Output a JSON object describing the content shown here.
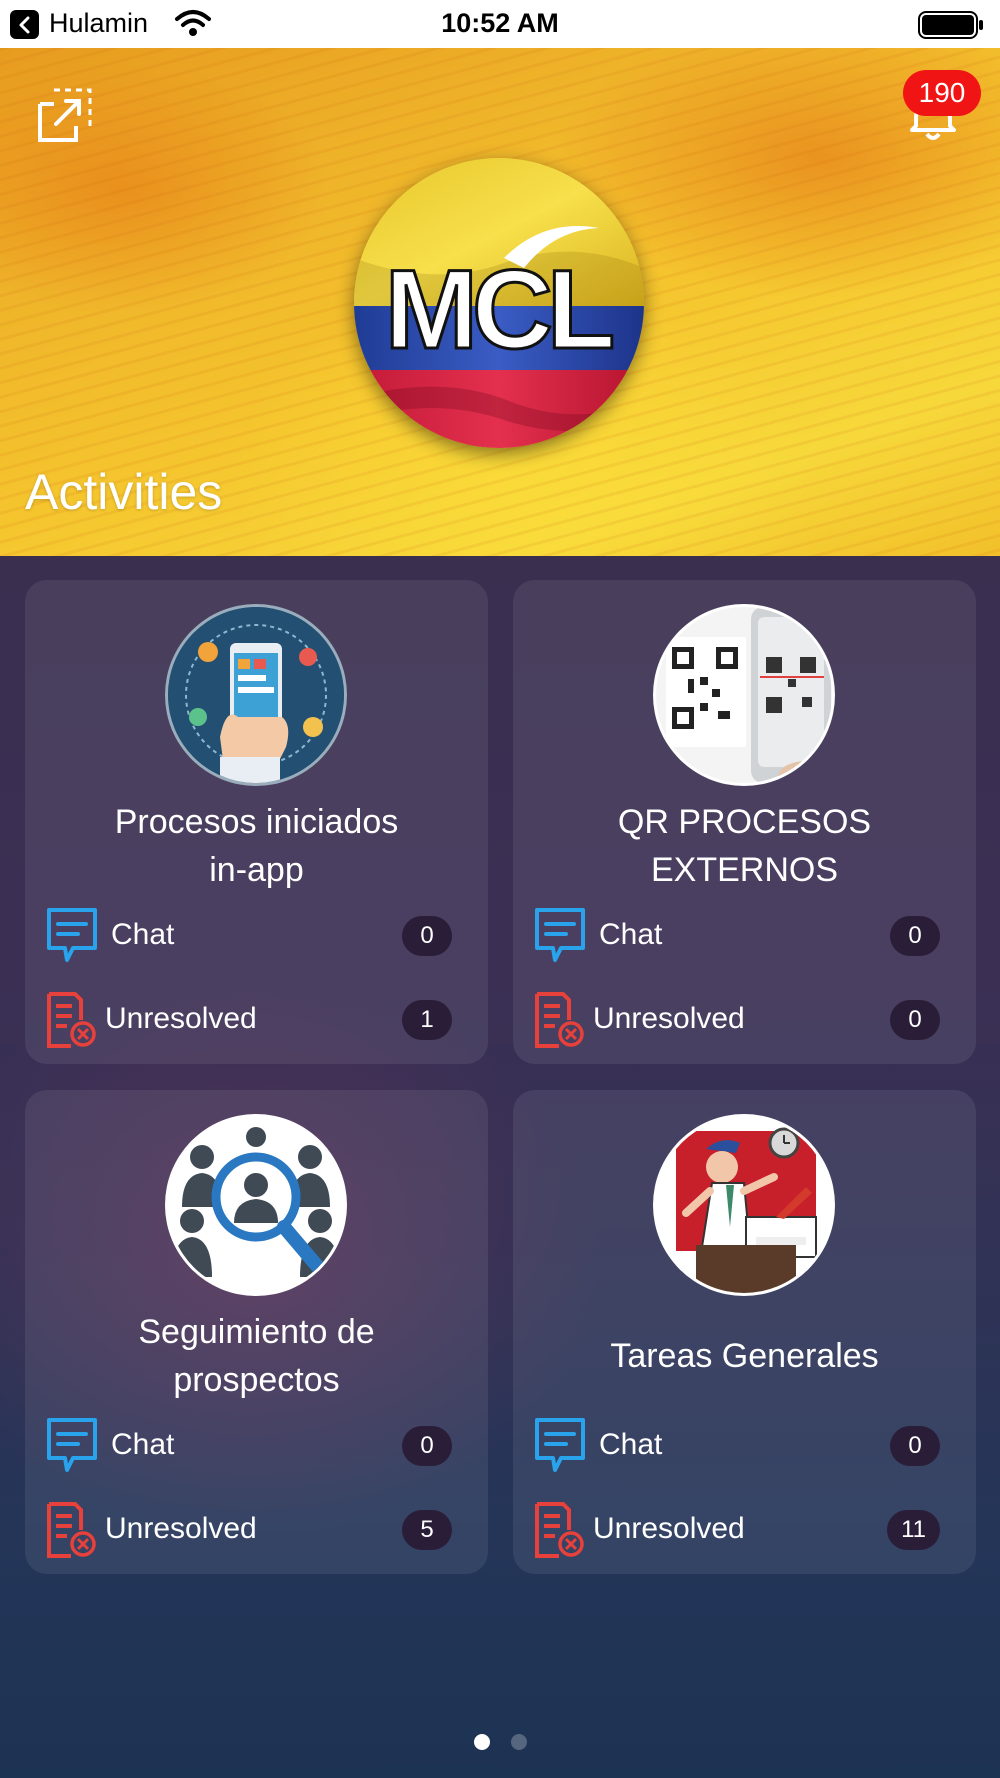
{
  "status_bar": {
    "carrier": "Hulamin",
    "time": "10:52 AM",
    "back_icon": "back-arrow-icon",
    "wifi_icon": "wifi-icon",
    "battery_icon": "battery-icon"
  },
  "header": {
    "title": "Activities",
    "notification_count": "190",
    "logo_text": "MCL",
    "share_icon": "share-icon",
    "bell_icon": "bell-icon",
    "colors": {
      "flag_yellow": "#f3d235",
      "flag_blue": "#2a49a8",
      "flag_red": "#d8233f",
      "badge": "#f01414"
    }
  },
  "cards": [
    {
      "title_line1": "Procesos iniciados",
      "title_line2": "in-app",
      "image": "mobile-app-illustration",
      "chat_label": "Chat",
      "chat_count": "0",
      "unresolved_label": "Unresolved",
      "unresolved_count": "1"
    },
    {
      "title_line1": "QR PROCESOS",
      "title_line2": "EXTERNOS",
      "image": "qr-code-scan-illustration",
      "chat_label": "Chat",
      "chat_count": "0",
      "unresolved_label": "Unresolved",
      "unresolved_count": "0"
    },
    {
      "title_line1": "Seguimiento de",
      "title_line2": "prospectos",
      "image": "prospect-search-illustration",
      "chat_label": "Chat",
      "chat_count": "0",
      "unresolved_label": "Unresolved",
      "unresolved_count": "5"
    },
    {
      "title_line1": "Tareas Generales",
      "title_line2": "",
      "image": "busy-office-worker-illustration",
      "chat_label": "Chat",
      "chat_count": "0",
      "unresolved_label": "Unresolved",
      "unresolved_count": "11"
    }
  ],
  "pagination": {
    "pages": 2,
    "active": 1
  },
  "icons": {
    "chat": "chat-icon",
    "unresolved": "unresolved-document-icon"
  },
  "accent_colors": {
    "chat_icon": "#29a3ec",
    "unresolved_icon": "#e8403a"
  }
}
